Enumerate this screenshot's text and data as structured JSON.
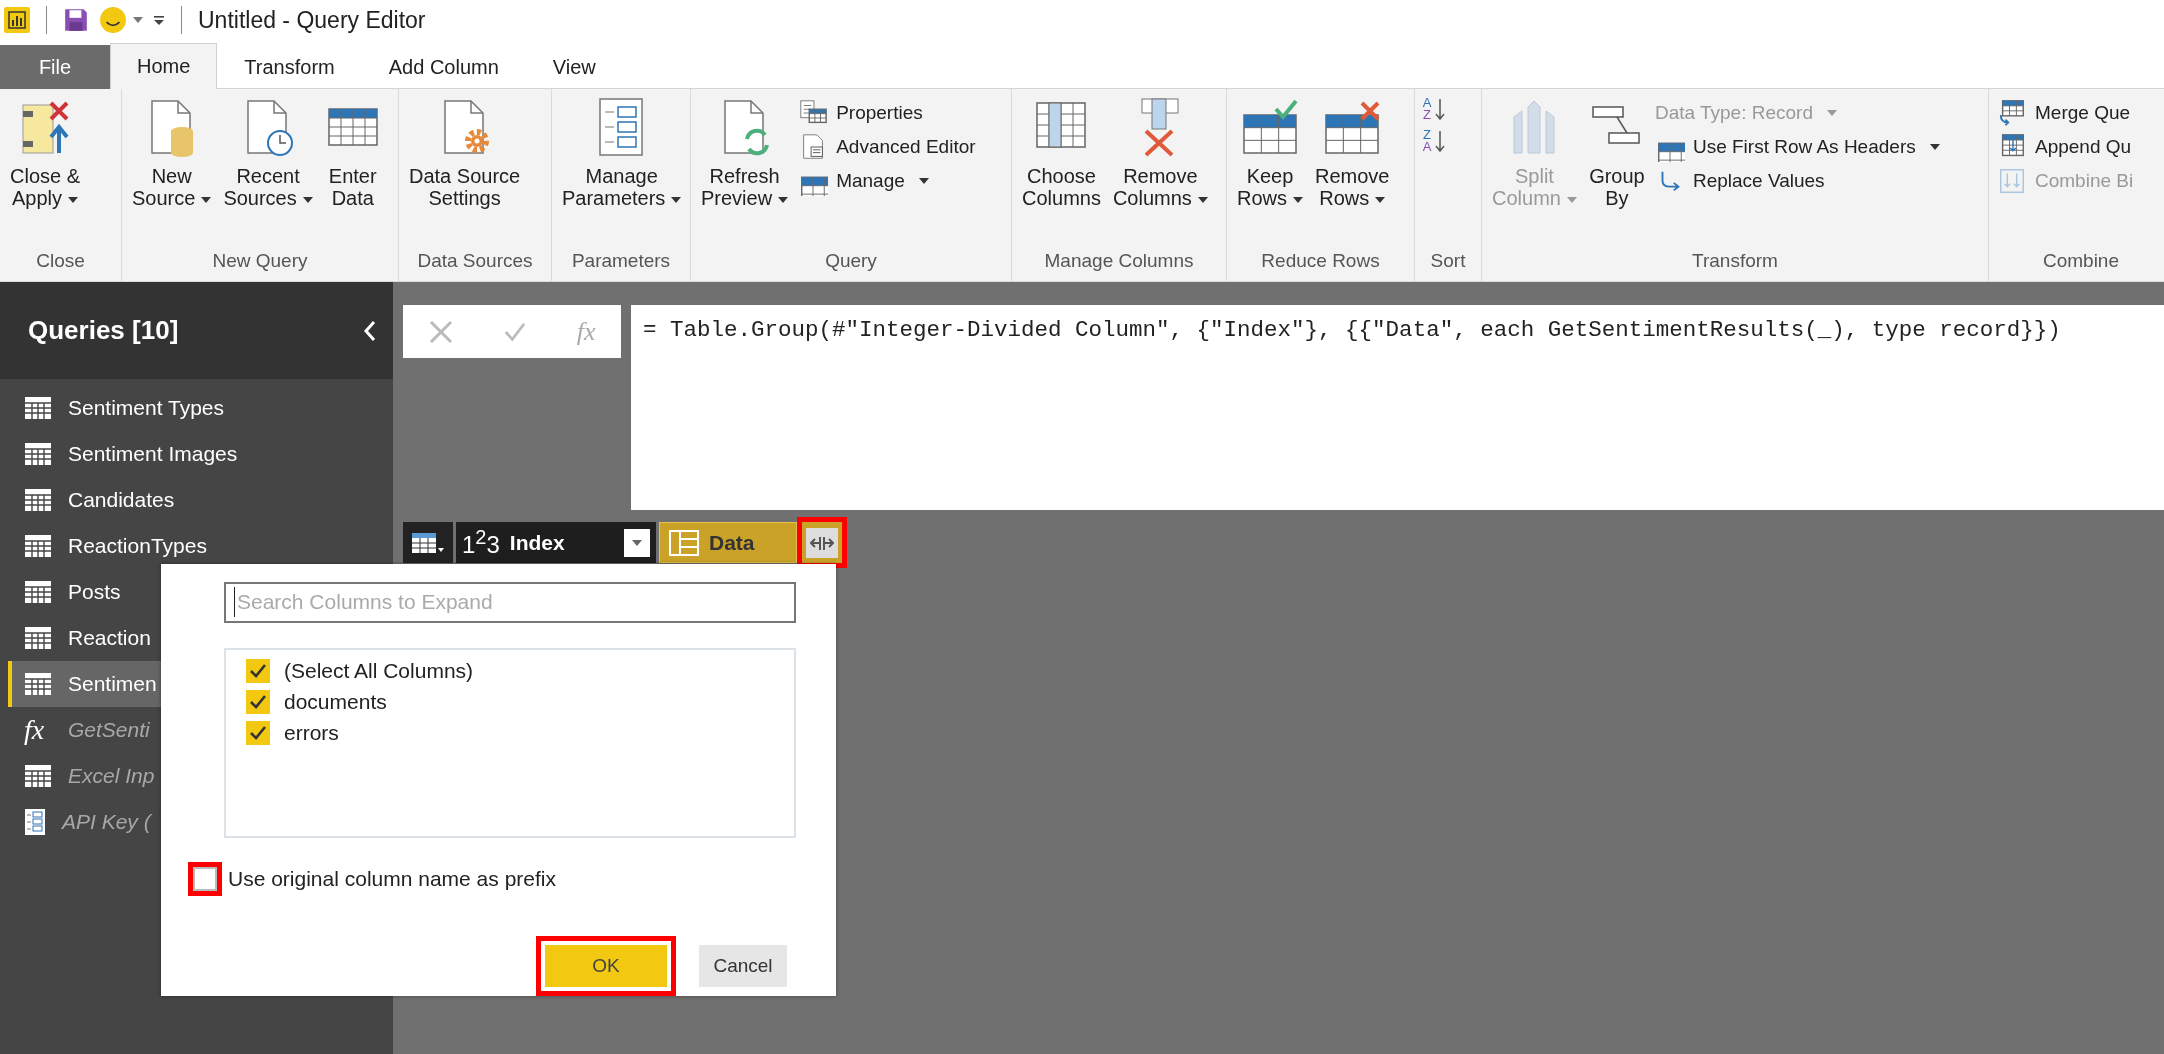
{
  "window": {
    "title": "Untitled - Query Editor"
  },
  "tabs": [
    {
      "label": "File",
      "kind": "file"
    },
    {
      "label": "Home",
      "kind": "tab",
      "selected": true
    },
    {
      "label": "Transform",
      "kind": "tab",
      "selected": false
    },
    {
      "label": "Add Column",
      "kind": "tab",
      "selected": false
    },
    {
      "label": "View",
      "kind": "tab",
      "selected": false
    }
  ],
  "ribbon": {
    "groups": [
      {
        "label": "Close",
        "items": [
          {
            "kind": "large",
            "lines": [
              "Close &",
              "Apply"
            ],
            "dropdown": true,
            "disabled": false
          }
        ]
      },
      {
        "label": "New Query",
        "items": [
          {
            "kind": "large",
            "lines": [
              "New",
              "Source"
            ],
            "dropdown": true,
            "disabled": false
          },
          {
            "kind": "large",
            "lines": [
              "Recent",
              "Sources"
            ],
            "dropdown": true,
            "disabled": false
          },
          {
            "kind": "large",
            "lines": [
              "Enter",
              "Data"
            ],
            "dropdown": false,
            "disabled": false
          }
        ]
      },
      {
        "label": "Data Sources",
        "items": [
          {
            "kind": "large",
            "lines": [
              "Data Source",
              "Settings"
            ],
            "dropdown": false,
            "disabled": false
          }
        ]
      },
      {
        "label": "Parameters",
        "items": [
          {
            "kind": "large",
            "lines": [
              "Manage",
              "Parameters"
            ],
            "dropdown": true,
            "disabled": false
          }
        ]
      },
      {
        "label": "Query",
        "items": [
          {
            "kind": "large",
            "lines": [
              "Refresh",
              "Preview"
            ],
            "dropdown": true,
            "disabled": false
          },
          {
            "kind": "stack",
            "items": [
              {
                "label": "Properties",
                "dropdown": false,
                "disabled": false
              },
              {
                "label": "Advanced Editor",
                "dropdown": false,
                "disabled": false
              },
              {
                "label": "Manage",
                "dropdown": true,
                "disabled": false
              }
            ]
          }
        ]
      },
      {
        "label": "Manage Columns",
        "items": [
          {
            "kind": "large",
            "lines": [
              "Choose",
              "Columns"
            ],
            "dropdown": false,
            "disabled": false
          },
          {
            "kind": "large",
            "lines": [
              "Remove",
              "Columns"
            ],
            "dropdown": true,
            "disabled": false
          }
        ]
      },
      {
        "label": "Reduce Rows",
        "items": [
          {
            "kind": "large",
            "lines": [
              "Keep",
              "Rows"
            ],
            "dropdown": true,
            "disabled": false
          },
          {
            "kind": "large",
            "lines": [
              "Remove",
              "Rows"
            ],
            "dropdown": true,
            "disabled": false
          }
        ]
      },
      {
        "label": "Sort",
        "items": [
          {
            "kind": "sort",
            "items": [
              {
                "top": "A",
                "bottom": "Z"
              },
              {
                "top": "Z",
                "bottom": "A"
              }
            ]
          }
        ]
      },
      {
        "label": "Transform",
        "items": [
          {
            "kind": "large",
            "lines": [
              "Split",
              "Column"
            ],
            "dropdown": true,
            "disabled": true
          },
          {
            "kind": "large",
            "lines": [
              "Group",
              "By"
            ],
            "dropdown": false,
            "disabled": false
          },
          {
            "kind": "stack",
            "items": [
              {
                "label": "Data Type: Record",
                "dropdown": true,
                "disabled": true
              },
              {
                "label": "Use First Row As Headers",
                "dropdown": true,
                "disabled": false
              },
              {
                "label": "Replace Values",
                "dropdown": false,
                "disabled": false
              }
            ]
          }
        ]
      },
      {
        "label": "Combine",
        "items": [
          {
            "kind": "stack",
            "items": [
              {
                "label": "Merge Que",
                "dropdown": false,
                "disabled": false
              },
              {
                "label": "Append Qu",
                "dropdown": false,
                "disabled": false
              },
              {
                "label": "Combine Bi",
                "dropdown": false,
                "disabled": true
              }
            ]
          }
        ]
      }
    ]
  },
  "queries": {
    "title": "Queries [10]",
    "items": [
      {
        "label": "Sentiment Types",
        "kind": "table",
        "selected": false,
        "load_disabled": false
      },
      {
        "label": "Sentiment Images",
        "kind": "table",
        "selected": false,
        "load_disabled": false
      },
      {
        "label": "Candidates",
        "kind": "table",
        "selected": false,
        "load_disabled": false
      },
      {
        "label": "ReactionTypes",
        "kind": "table",
        "selected": false,
        "load_disabled": false
      },
      {
        "label": "Posts",
        "kind": "table",
        "selected": false,
        "load_disabled": false
      },
      {
        "label": "Reaction",
        "kind": "table",
        "selected": false,
        "load_disabled": false
      },
      {
        "label": "Sentimen",
        "kind": "table",
        "selected": true,
        "load_disabled": false
      },
      {
        "label": "GetSenti",
        "kind": "function",
        "glyph": "fx",
        "selected": false,
        "load_disabled": true
      },
      {
        "label": "Excel Inp",
        "kind": "table",
        "selected": false,
        "load_disabled": true
      },
      {
        "label": "API Key (",
        "kind": "parameter",
        "selected": false,
        "load_disabled": true
      }
    ]
  },
  "formula_bar": {
    "fx_label": "fx",
    "formula": "= Table.Group(#\"Integer-Divided Column\", {\"Index\"}, {{\"Data\", each GetSentimentResults(_), type record}})"
  },
  "columns": [
    {
      "kind": "number",
      "type_label": "1$^{2}$3",
      "name": "Index",
      "selected": false
    },
    {
      "kind": "record",
      "name": "Data",
      "selected": true,
      "expand_highlighted": true
    }
  ],
  "expand_dialog": {
    "search": {
      "placeholder": "Search Columns to Expand"
    },
    "columns": [
      {
        "label": "(Select All Columns)",
        "checked": true
      },
      {
        "label": "documents",
        "checked": true
      },
      {
        "label": "errors",
        "checked": true
      }
    ],
    "prefix": {
      "label": "Use original column name as prefix",
      "checked": false,
      "highlighted": true
    },
    "buttons": [
      {
        "label": "OK",
        "kind": "primary",
        "highlighted": true
      },
      {
        "label": "Cancel",
        "kind": "secondary",
        "highlighted": false
      }
    ]
  }
}
